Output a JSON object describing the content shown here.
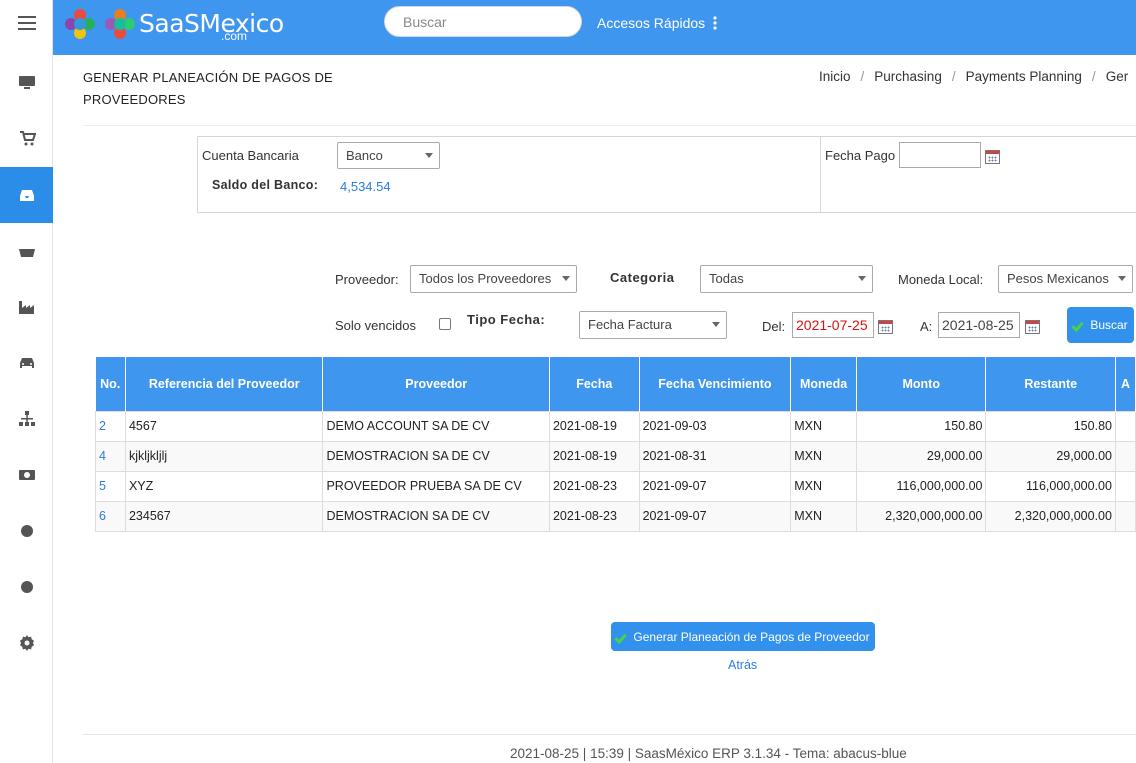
{
  "header": {
    "logo_text": "SaaSMexico",
    "logo_sub": ".com",
    "search_placeholder": "Buscar",
    "quick_access": "Accesos Rápidos",
    "color": "#3f96ee"
  },
  "sidebar": {
    "items": [
      {
        "icon": "monitor-icon"
      },
      {
        "icon": "cart-icon"
      },
      {
        "icon": "inbox-icon",
        "active": true
      },
      {
        "icon": "basket-icon"
      },
      {
        "icon": "factory-icon"
      },
      {
        "icon": "car-icon"
      },
      {
        "icon": "org-chart-icon"
      },
      {
        "icon": "money-icon"
      },
      {
        "icon": "circle-icon"
      },
      {
        "icon": "circle-icon"
      },
      {
        "icon": "gear-icon"
      }
    ]
  },
  "page": {
    "title": "GENERAR PLANEACIÓN DE PAGOS DE PROVEEDORES",
    "breadcrumb": [
      "Inicio",
      "Purchasing",
      "Payments Planning",
      "Ger"
    ]
  },
  "bank": {
    "account_label": "Cuenta Bancaria",
    "account_value": "Banco",
    "balance_label": "Saldo del Banco:",
    "balance_value": "4,534.54",
    "pay_date_label": "Fecha Pago",
    "pay_date_value": ""
  },
  "filters": {
    "provider_label": "Proveedor:",
    "provider_value": "Todos los Proveedores",
    "category_label": "Categoria",
    "category_value": "Todas",
    "currency_label": "Moneda Local:",
    "currency_value": "Pesos Mexicanos",
    "overdue_label": "Solo vencidos",
    "date_type_label": "Tipo Fecha:",
    "date_type_value": "Fecha Factura",
    "from_label": "Del:",
    "from_value": "2021-07-25",
    "to_label": "A:",
    "to_value": "2021-08-25",
    "search_button": "Buscar"
  },
  "table": {
    "columns": [
      "No.",
      "Referencia del Proveedor",
      "Proveedor",
      "Fecha",
      "Fecha Vencimiento",
      "Moneda",
      "Monto",
      "Restante",
      "A"
    ],
    "rows": [
      [
        "2",
        "4567",
        "DEMO ACCOUNT SA DE CV",
        "2021-08-19",
        "2021-09-03",
        "MXN",
        "150.80",
        "150.80"
      ],
      [
        "4",
        "kjkljkljlj",
        "DEMOSTRACION SA DE CV",
        "2021-08-19",
        "2021-08-31",
        "MXN",
        "29,000.00",
        "29,000.00"
      ],
      [
        "5",
        "XYZ",
        "PROVEEDOR PRUEBA SA DE CV",
        "2021-08-23",
        "2021-09-07",
        "MXN",
        "116,000,000.00",
        "116,000,000.00"
      ],
      [
        "6",
        "234567",
        "DEMOSTRACION SA DE CV",
        "2021-08-23",
        "2021-09-07",
        "MXN",
        "2,320,000,000.00",
        "2,320,000,000.00"
      ]
    ]
  },
  "actions": {
    "generate_button": "Generar Planeación de Pagos de Proveedor",
    "back_link": "Atrás"
  },
  "footer": {
    "text": "2021-08-25 | 15:39 | SaasMéxico ERP 3.1.34 - Tema: abacus-blue"
  }
}
